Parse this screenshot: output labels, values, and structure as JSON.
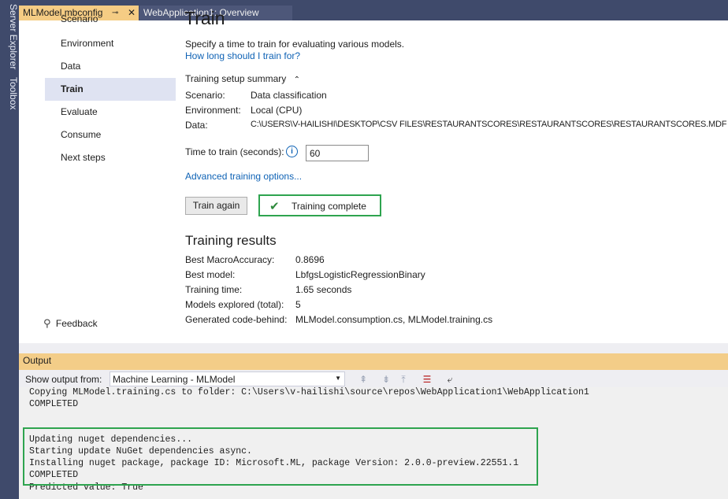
{
  "sidepanel": {
    "server_explorer": "Server Explorer",
    "toolbox": "Toolbox"
  },
  "tabs": {
    "active_tab": "MLModel.mbconfig",
    "pin_icon": "pin-icon",
    "close_icon": "close-icon",
    "second_tab": "WebApplication1: Overview"
  },
  "nav": {
    "items": [
      "Scenario",
      "Environment",
      "Data",
      "Train",
      "Evaluate",
      "Consume",
      "Next steps"
    ],
    "active": "Train",
    "feedback": "Feedback"
  },
  "train": {
    "heading": "Train",
    "description": "Specify a time to train for evaluating various models.",
    "help_link": "How long should I train for?",
    "summary_title": "Training setup summary",
    "summary": {
      "scenario_label": "Scenario:",
      "scenario_value": "Data classification",
      "environment_label": "Environment:",
      "environment_value": "Local (CPU)",
      "data_label": "Data:",
      "data_value": "C:\\USERS\\V-HAILISHI\\DESKTOP\\CSV FILES\\RESTAURANTSCORES\\RESTAURANTSCORES\\RESTAURANTSCORES.MDF"
    },
    "time_label": "Time to train (seconds):",
    "time_value": "60",
    "advanced_link": "Advanced training options...",
    "train_again_button": "Train again",
    "status": "Training complete"
  },
  "results": {
    "title": "Training results",
    "rows": [
      {
        "label": "Best MacroAccuracy:",
        "value": "0.8696"
      },
      {
        "label": "Best model:",
        "value": "LbfgsLogisticRegressionBinary"
      },
      {
        "label": "Training time:",
        "value": "1.65 seconds"
      },
      {
        "label": "Models explored (total):",
        "value": "5"
      },
      {
        "label": "Generated code-behind:",
        "value": "MLModel.consumption.cs, MLModel.training.cs"
      }
    ]
  },
  "output": {
    "title": "Output",
    "show_from_label": "Show output from:",
    "source_selected": "Machine Learning - MLModel",
    "lines": [
      "Copying MLModel.training.cs to folder: C:\\Users\\v-hailishi\\source\\repos\\WebApplication1\\WebApplication1",
      "COMPLETED",
      "",
      "",
      "Updating nuget dependencies...",
      "Starting update NuGet dependencies async.",
      "Installing nuget package, package ID: Microsoft.ML, package Version: 2.0.0-preview.22551.1",
      "COMPLETED",
      "Predicted value: True"
    ]
  },
  "colors": {
    "chrome": "#3f4a6b",
    "active_tab": "#f5cc84",
    "link": "#0e62b5",
    "success_border": "#2ea44f",
    "nav_active": "#dfe3f2"
  }
}
